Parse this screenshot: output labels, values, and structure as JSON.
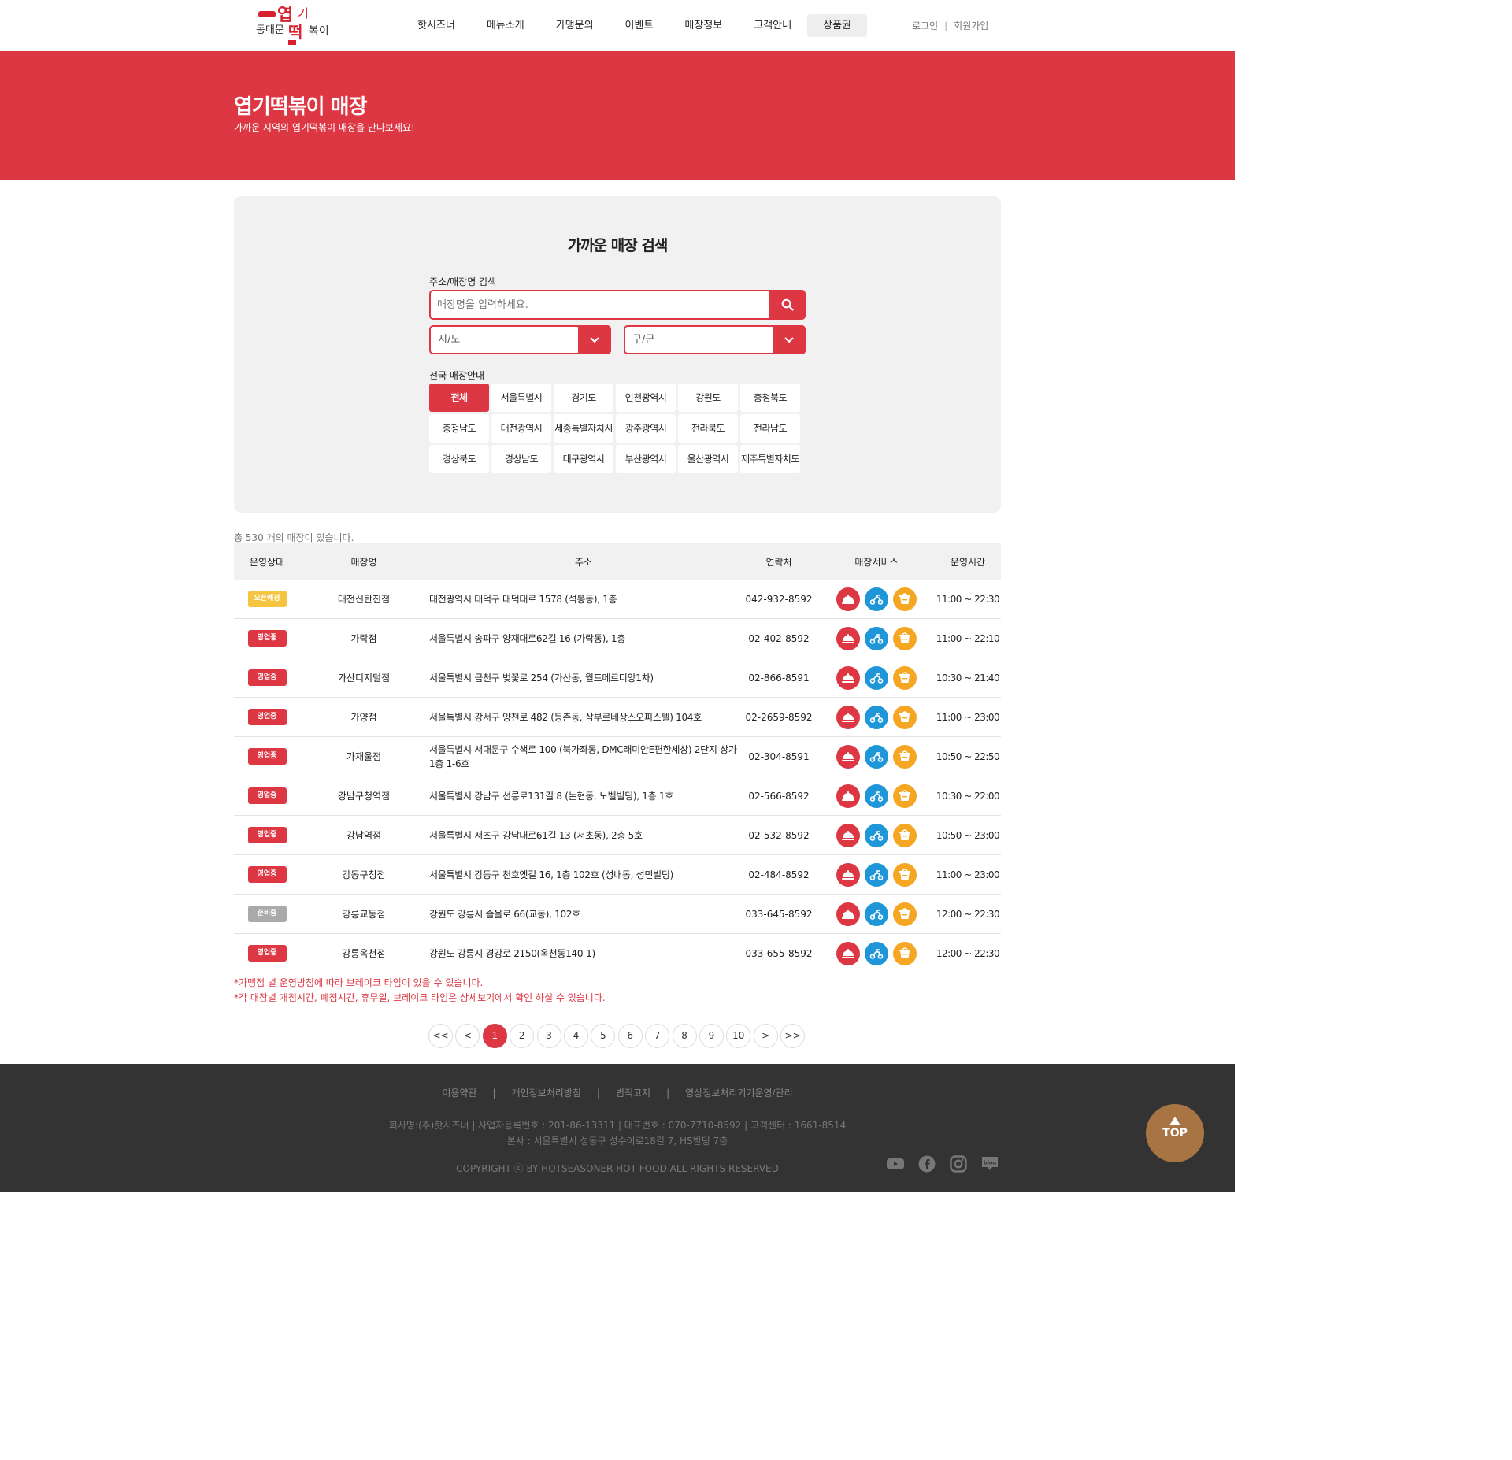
{
  "header": {
    "logo_text": "동대문엽기떡볶이",
    "nav": [
      "핫시즈너",
      "메뉴소개",
      "가맹문의",
      "이벤트",
      "매장정보",
      "고객안내",
      "상품권"
    ],
    "nav_active_index": 6,
    "login": "로그인",
    "signup": "회원가입"
  },
  "banner": {
    "title": "엽기떡볶이 매장",
    "subtitle": "가까운 지역의 엽기떡볶이 매장을 만나보세요!"
  },
  "search": {
    "title": "가까운 매장 검색",
    "label": "주소/매장명 검색",
    "placeholder": "매장명을 입력하세요.",
    "sido": "시/도",
    "gugun": "구/군",
    "regions_label": "전국 매장안내",
    "regions": [
      "전체",
      "서울특별시",
      "경기도",
      "인천광역시",
      "강원도",
      "충청북도",
      "충청남도",
      "대전광역시",
      "세종특별자치시",
      "광주광역시",
      "전라북도",
      "전라남도",
      "경상북도",
      "경상남도",
      "대구광역시",
      "부산광역시",
      "울산광역시",
      "제주특별자치도"
    ],
    "region_active_index": 0
  },
  "stores": {
    "total_text": "총 530 개의 매장이 있습니다.",
    "columns": [
      "운영상태",
      "매장명",
      "주소",
      "연락처",
      "매장서비스",
      "운영시간"
    ],
    "status_colors": {
      "오픈예정": "#f5c542",
      "영업중": "#dd3744",
      "준비중": "#aaaaaa"
    },
    "rows": [
      {
        "status": "오픈예정",
        "name": "대전신탄진점",
        "address": "대전광역시 대덕구 대덕대로 1578 (석봉동), 1층",
        "phone": "042-932-8592",
        "hours": "11:00 ~ 22:30"
      },
      {
        "status": "영업중",
        "name": "가락점",
        "address": "서울특별시 송파구 양재대로62길 16 (가락동), 1층",
        "phone": "02-402-8592",
        "hours": "11:00 ~ 22:10"
      },
      {
        "status": "영업중",
        "name": "가산디지털점",
        "address": "서울특별시 금천구 벚꽃로 254 (가산동, 월드메르디앙1차)",
        "phone": "02-866-8591",
        "hours": "10:30 ~ 21:40"
      },
      {
        "status": "영업중",
        "name": "가양점",
        "address": "서울특별시 강서구 양천로 482 (등촌동, 삼부르네상스오피스텔) 104호",
        "phone": "02-2659-8592",
        "hours": "11:00 ~ 23:00"
      },
      {
        "status": "영업중",
        "name": "가재울점",
        "address": "서울특별시 서대문구 수색로 100 (북가좌동, DMC래미안E편한세상) 2단지 상가 1층 1-6호",
        "phone": "02-304-8591",
        "hours": "10:50 ~ 22:50"
      },
      {
        "status": "영업중",
        "name": "강남구청역점",
        "address": "서울특별시 강남구 선릉로131길 8 (논현동, 노벨빌딩), 1층 1호",
        "phone": "02-566-8592",
        "hours": "10:30 ~ 22:00"
      },
      {
        "status": "영업중",
        "name": "강남역점",
        "address": "서울특별시 서초구 강남대로61길 13 (서초동), 2층 5호",
        "phone": "02-532-8592",
        "hours": "10:50 ~ 23:00"
      },
      {
        "status": "영업중",
        "name": "강동구청점",
        "address": "서울특별시 강동구 천호옛길 16, 1층 102호 (성내동, 성민빌딩)",
        "phone": "02-484-8592",
        "hours": "11:00 ~ 23:00"
      },
      {
        "status": "준비중",
        "name": "강릉교동점",
        "address": "강원도 강릉시 솔올로 66(교동), 102호",
        "phone": "033-645-8592",
        "hours": "12:00 ~ 22:30"
      },
      {
        "status": "영업중",
        "name": "강릉옥천점",
        "address": "강원도 강릉시 경강로 2150(옥천동140-1)",
        "phone": "033-655-8592",
        "hours": "12:00 ~ 22:30"
      }
    ],
    "services": [
      "dine-in-icon",
      "delivery-icon",
      "takeout-icon"
    ]
  },
  "notes": [
    "*가맹점 별 운영방침에 따라 브레이크 타임이 있을 수 있습니다.",
    "*각 매장별 개점시간, 폐점시간, 휴무일, 브레이크 타임은 상세보기에서 확인 하실 수 있습니다."
  ],
  "pagination": {
    "first": "<<",
    "prev": "<",
    "pages": [
      "1",
      "2",
      "3",
      "4",
      "5",
      "6",
      "7",
      "8",
      "9",
      "10"
    ],
    "active_index": 0,
    "next": ">",
    "last": ">>"
  },
  "footer": {
    "links": [
      "이용약관",
      "개인정보처리방침",
      "법적고지",
      "영상정보처리기기운영/관리"
    ],
    "info_line1": "회사명:(주)핫시즈너 | 사업자등록번호 : 201-86-13311 | 대표번호 : 070-7710-8592 | 고객센터 : 1661-8514",
    "info_line2": "본사 : 서울특별시 성동구 성수이로18길 7, HS빌딩 7층",
    "copyright": "COPYRIGHT ⓒ BY HOTSEASONER HOT FOOD ALL RIGHTS RESERVED",
    "social": [
      "youtube-icon",
      "facebook-icon",
      "instagram-icon",
      "blog-icon"
    ],
    "top_label": "TOP"
  },
  "colors": {
    "brand_red": "#dd3744",
    "delivery_blue": "#1e96d8",
    "takeout_orange": "#f5a623",
    "top_brown": "#a87444"
  }
}
